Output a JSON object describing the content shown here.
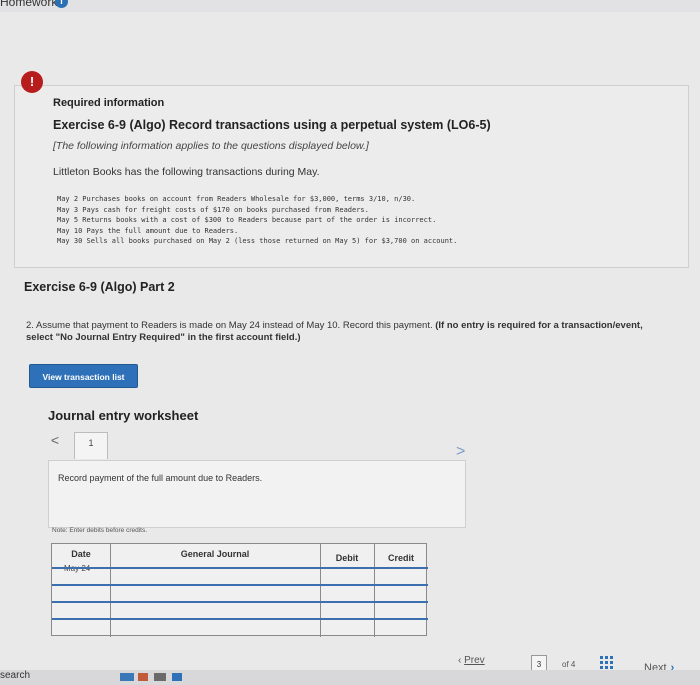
{
  "header": {
    "tab_label": "Homework",
    "badge": "i"
  },
  "info": {
    "required_title": "Required information",
    "exercise_title": "Exercise 6-9 (Algo) Record transactions using a perpetual system (LO6-5)",
    "note": "[The following information applies to the questions displayed below.]",
    "intro": "Littleton Books has the following transactions during May.",
    "transactions": [
      "May 2 Purchases books on account from Readers Wholesale for $3,000, terms 3/10, n/30.",
      "May 3 Pays cash for freight costs of $170 on books purchased from Readers.",
      "May 5 Returns books with a cost of $300 to Readers because part of the order is incorrect.",
      "May 10 Pays the full amount due to Readers.",
      "May 30 Sells all books purchased on May 2 (less those returned on May 5) for $3,700 on account."
    ],
    "alert_icon": "!"
  },
  "part": {
    "title": "Exercise 6-9 (Algo) Part 2",
    "question": "2. Assume that payment to Readers is made on May 24 instead of May 10. Record this payment.",
    "question_bold": "(If no entry is required for a transaction/event, select \"No Journal Entry Required\" in the first account field.)",
    "view_button": "View transaction list"
  },
  "worksheet": {
    "title": "Journal entry worksheet",
    "tab_number": "1",
    "prev_arrow": "<",
    "next_arrow": ">",
    "entry_description": "Record payment of the full amount due to Readers.",
    "note": "Note: Enter debits before credits.",
    "columns": [
      "Date",
      "General Journal",
      "Debit",
      "Credit"
    ],
    "first_date": "May 24"
  },
  "nav": {
    "prev_label": "Prev",
    "page_current": "3",
    "page_total": "of 4",
    "next_label": "Next"
  },
  "taskbar": {
    "search_label": "search"
  }
}
